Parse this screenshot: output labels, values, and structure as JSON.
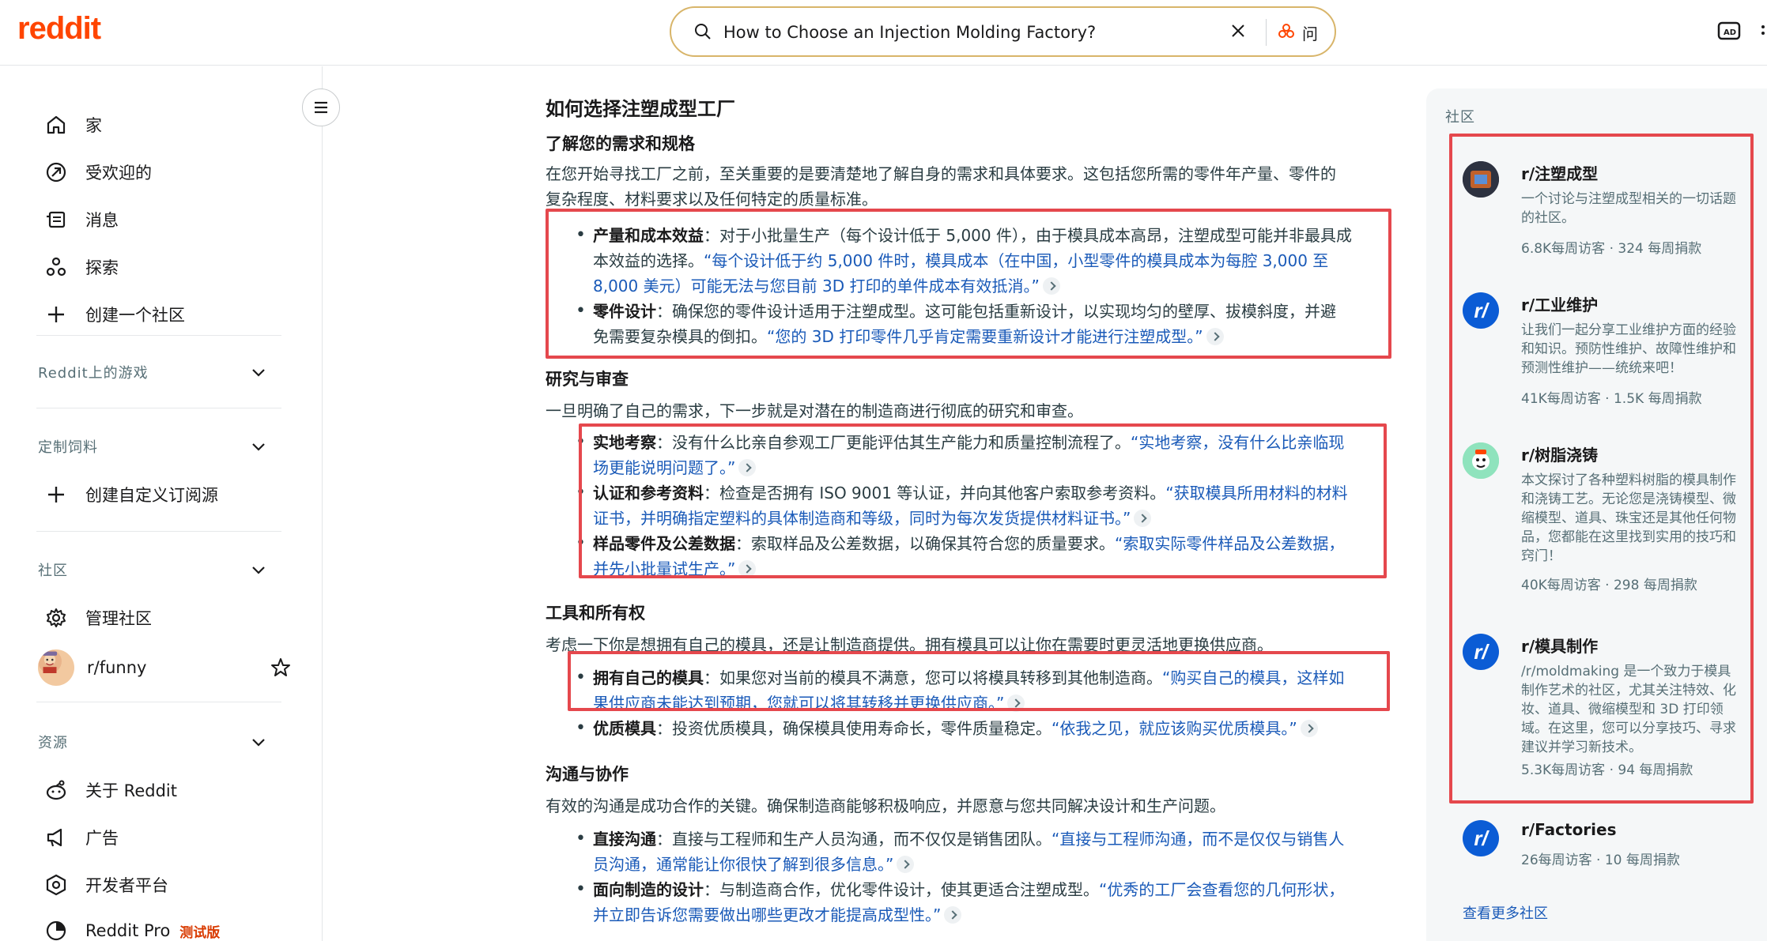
{
  "header": {
    "logo": "reddit",
    "search_value": "How to Choose an Injection Molding Factory?",
    "ask_label": "问"
  },
  "sidebar": {
    "nav": [
      {
        "label": "家",
        "icon": "home-icon"
      },
      {
        "label": "受欢迎的",
        "icon": "popular-icon"
      },
      {
        "label": "消息",
        "icon": "news-icon"
      },
      {
        "label": "探索",
        "icon": "explore-icon"
      },
      {
        "label": "创建一个社区",
        "icon": "plus-icon"
      }
    ],
    "games_title": "Reddit上的游戏",
    "custom_feeds_title": "定制饲料",
    "create_feed_label": "创建自定义订阅源",
    "communities_title": "社区",
    "manage_communities_label": "管理社区",
    "funny_label": "r/funny",
    "resources_title": "资源",
    "resources": [
      {
        "label": "关于 Reddit",
        "icon": "reddit-alien-icon"
      },
      {
        "label": "广告",
        "icon": "megaphone-icon"
      },
      {
        "label": "开发者平台",
        "icon": "developer-icon"
      },
      {
        "label": "Reddit Pro",
        "icon": "pro-icon"
      }
    ],
    "beta_badge": "测试版"
  },
  "article": {
    "title": "如何选择注塑成型工厂",
    "s1_heading": "了解您的需求和规格",
    "s1_intro_line1": "在您开始寻找工厂之前，至关重要的是要清楚地了解自身的需求和具体要求。这包括您所需的零件年产量、零件的",
    "s1_intro_line2": "复杂程度、材料要求以及任何特定的质量标准。",
    "b1_label": "产量和成本效益",
    "b1_text": "：对于小批量生产（每个设计低于 5,000 件），由于模具成本高昂，注塑成型可能并非最具成",
    "b1_text2": "本效益的选择。",
    "b1_quote1": "“每个设计低于约 5,000 件时，模具成本（在中国，小型零件的模具成本为每腔 3,000 至",
    "b1_quote2": "8,000 美元）可能无法与您目前 3D 打印的单件成本有效抵消。”",
    "b2_label": "零件设计",
    "b2_text": "：确保您的零件设计适用于注塑成型。这可能包括重新设计，以实现均匀的壁厚、拔模斜度，并避",
    "b2_text2": "免需要复杂模具的倒扣。",
    "b2_quote": "“您的 3D 打印零件几乎肯定需要重新设计才能进行注塑成型。”",
    "s2_heading": "研究与审查",
    "s2_intro": "一旦明确了自己的需求，下一步就是对潜在的制造商进行彻底的研究和审查。",
    "b3_label": "实地考察",
    "b3_text": "：没有什么比亲自参观工厂更能评估其生产能力和质量控制流程了。",
    "b3_quote1": "“实地考察，没有什么比亲临现",
    "b3_quote2": "场更能说明问题了。”",
    "b4_label": "认证和参考资料",
    "b4_text": "：检查是否拥有 ISO 9001 等认证，并向其他客户索取参考资料。",
    "b4_quote1": "“获取模具所用材料的材料",
    "b4_quote2": "证书，并明确指定塑料的具体制造商和等级，同时为每次发货提供材料证书。”",
    "b5_label": "样品零件及公差数据",
    "b5_text": "：索取样品及公差数据，以确保其符合您的质量要求。",
    "b5_quote1": "“索取实际零件样品及公差数据，",
    "b5_quote2": "并先小批量试生产。”",
    "s3_heading": "工具和所有权",
    "s3_intro": "考虑一下你是想拥有自己的模具，还是让制造商提供。拥有模具可以让你在需要时更灵活地更换供应商。",
    "b6_label": "拥有自己的模具",
    "b6_text": "：如果您对当前的模具不满意，您可以将模具转移到其他制造商。",
    "b6_quote1": "“购买自己的模具，这样如",
    "b6_quote2": "果供应商未能达到预期，您就可以将其转移并更换供应商。”",
    "b7_label": "优质模具",
    "b7_text": "：投资优质模具，确保模具使用寿命长，零件质量稳定。",
    "b7_quote": "“依我之见，就应该购买优质模具。”",
    "s4_heading": "沟通与协作",
    "s4_intro": "有效的沟通是成功合作的关键。确保制造商能够积极响应，并愿意与您共同解决设计和生产问题。",
    "b8_label": "直接沟通",
    "b8_text": "：直接与工程师和生产人员沟通，而不仅仅是销售团队。",
    "b8_quote1": "“直接与工程师沟通，而不是仅仅与销售人",
    "b8_quote2": "员沟通，通常能让你很快了解到很多信息。”",
    "b9_label": "面向制造的设计",
    "b9_text": "：与制造商合作，优化零件设计，使其更适合注塑成型。",
    "b9_quote1": "“优秀的工厂会查看您的几何形状，",
    "b9_quote2": "并立即告诉您需要做出哪些更改才能提高成型性。”"
  },
  "communities": {
    "title": "社区",
    "items": [
      {
        "name": "r/注塑成型",
        "desc": "一个讨论与注塑成型相关的一切话题的社区。",
        "stats": "6.8K每周访客 · 324 每周捐款"
      },
      {
        "name": "r/工业维护",
        "desc": "让我们一起分享工业维护方面的经验和知识。预防性维护、故障性维护和预测性维护——统统来吧！",
        "stats": "41K每周访客 · 1.5K 每周捐款"
      },
      {
        "name": "r/树脂浇铸",
        "desc": "本文探讨了各种塑料树脂的模具制作和浇铸工艺。无论您是浇铸模型、微缩模型、道具、珠宝还是其他任何物品，您都能在这里找到实用的技巧和窍门！",
        "stats": "40K每周访客 · 298 每周捐款"
      },
      {
        "name": "r/模具制作",
        "desc": "/r/moldmaking 是一个致力于模具制作艺术的社区，尤其关注特效、化妆、道具、微缩模型和 3D 打印领域。在这里，您可以分享技巧、寻求建议并学习新技术。",
        "stats": "5.3K每周访客 · 94 每周捐款"
      },
      {
        "name": "r/Factories",
        "desc": "",
        "stats": "26每周访客 · 10 每周捐款"
      }
    ],
    "see_more": "查看更多社区",
    "reddit_glyph": "r/"
  },
  "colors": {
    "brand": "#ff4500",
    "highlight": "#e5484d",
    "link": "#1a5ab8"
  }
}
